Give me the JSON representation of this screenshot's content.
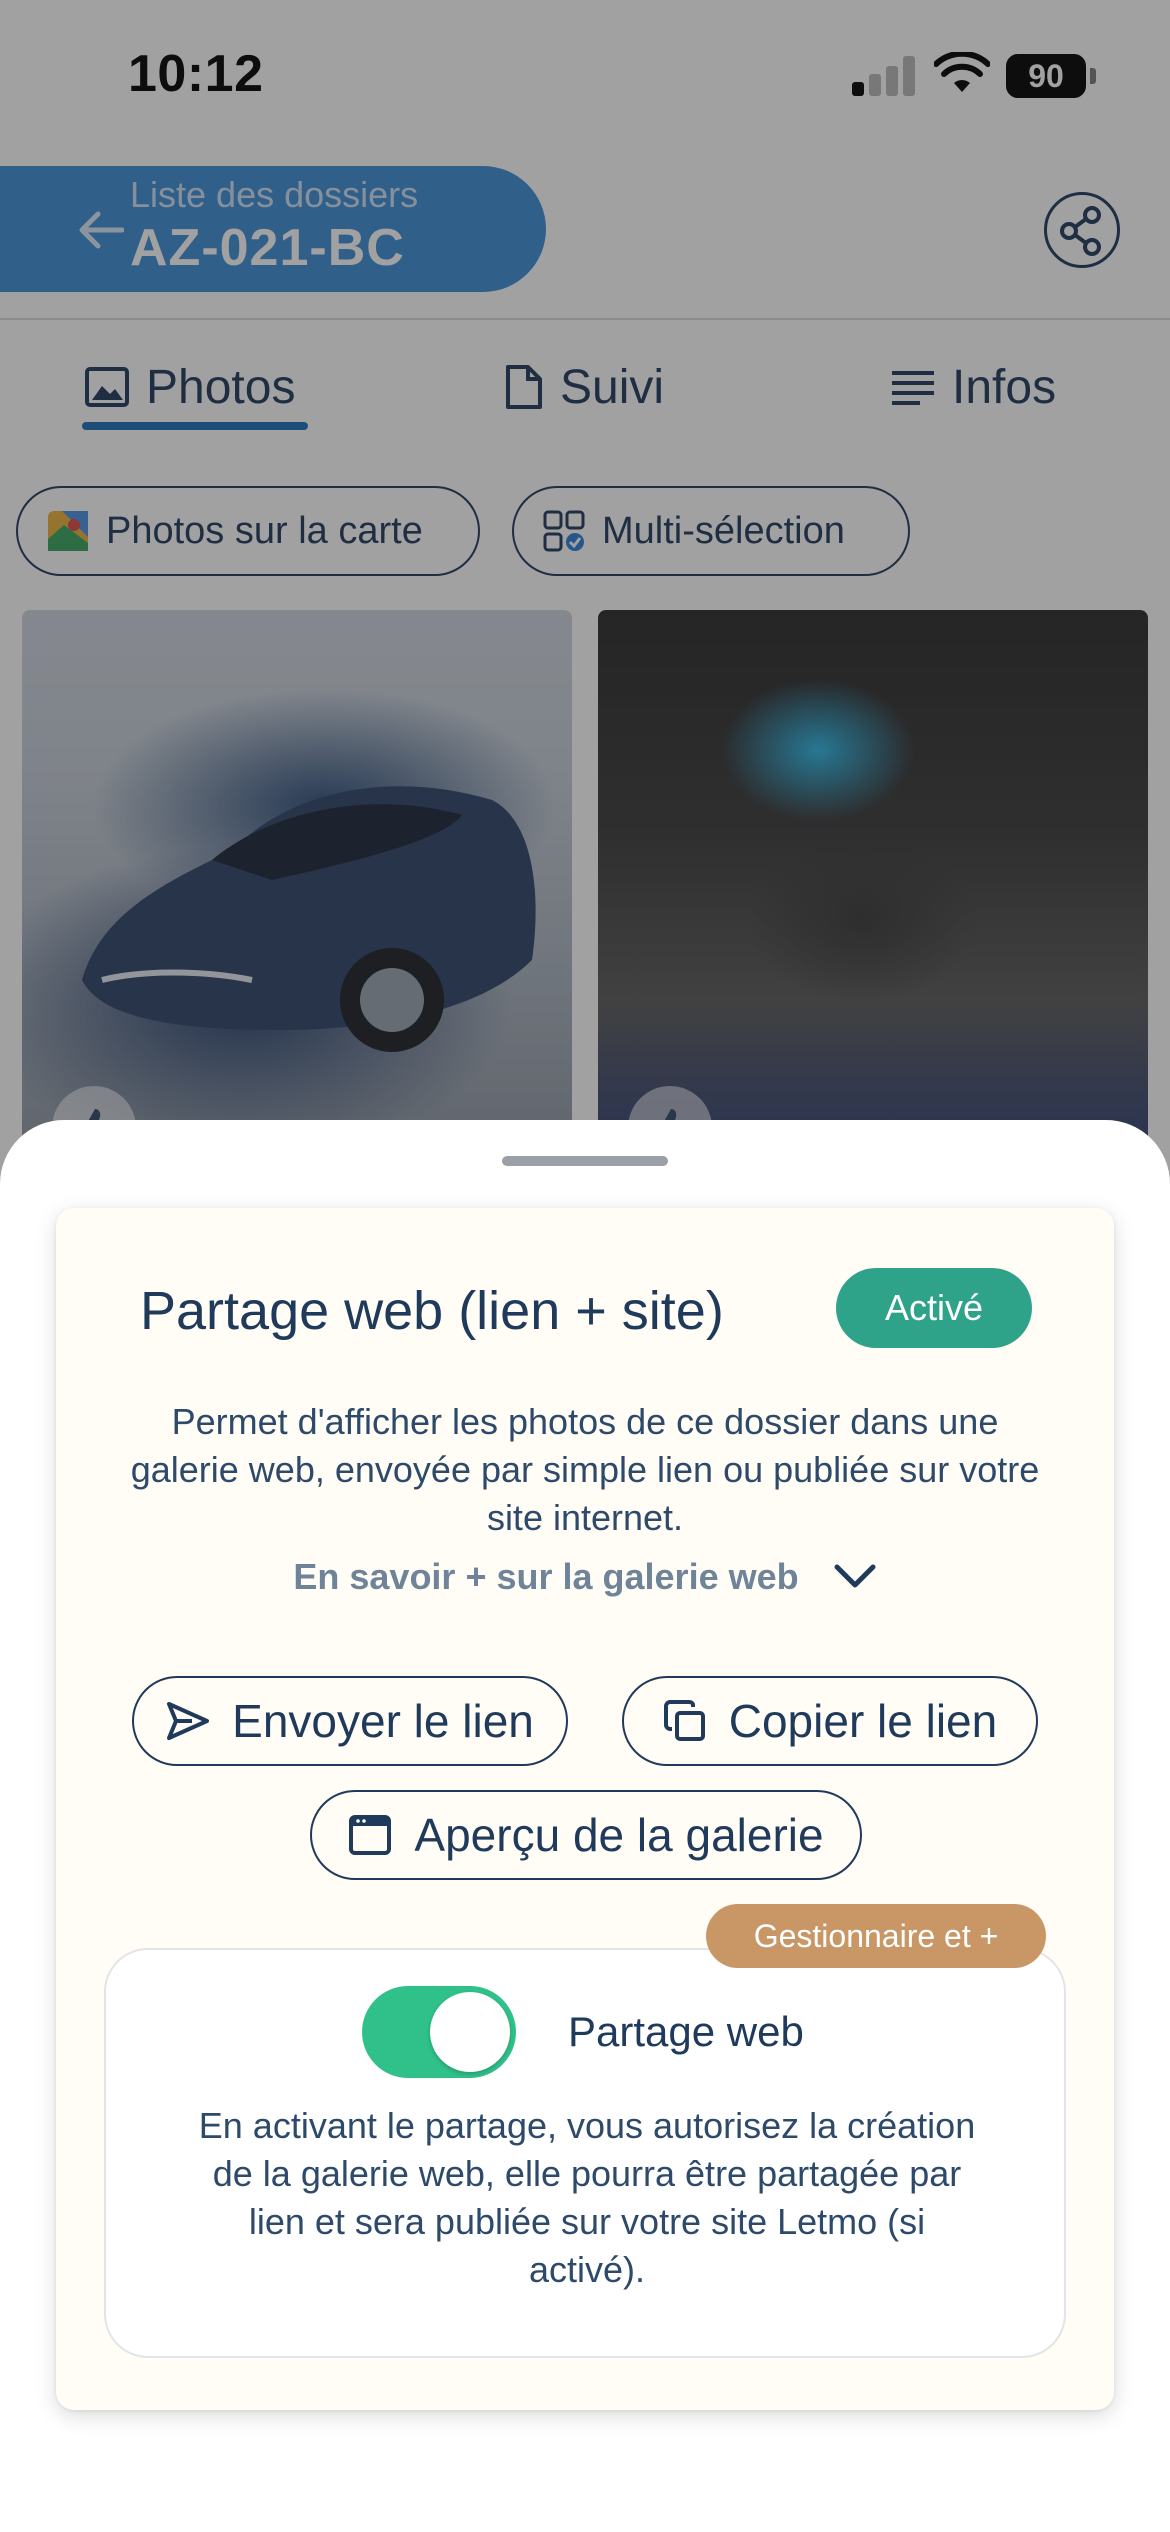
{
  "status_bar": {
    "time": "10:12",
    "battery": "90"
  },
  "header": {
    "subtitle": "Liste des dossiers",
    "title": "AZ-021-BC",
    "back_icon": "arrow-left-icon",
    "share_icon": "share-icon"
  },
  "tabs": [
    {
      "label": "Photos",
      "icon": "image-icon",
      "active": true
    },
    {
      "label": "Suivi",
      "icon": "document-icon",
      "active": false
    },
    {
      "label": "Infos",
      "icon": "lines-icon",
      "active": false
    }
  ],
  "chips": [
    {
      "label": "Photos sur la carte",
      "icon": "map-icon"
    },
    {
      "label": "Multi-sélection",
      "icon": "grid-check-icon"
    }
  ],
  "photos": [
    {
      "subject": "car",
      "like_icon": "thumbs-up-icon"
    },
    {
      "subject": "engine",
      "like_icon": "thumbs-up-icon"
    }
  ],
  "sheet": {
    "title": "Partage web (lien + site)",
    "status": "Activé",
    "description": "Permet d'afficher les photos de ce dossier dans une galerie web, envoyée par simple lien ou publiée sur votre site internet.",
    "learn_more": "En savoir + sur la galerie web",
    "buttons": {
      "send_link": "Envoyer le lien",
      "copy_link": "Copier le lien",
      "preview": "Aperçu de la galerie"
    },
    "role_badge": "Gestionnaire et +",
    "toggle_label": "Partage web",
    "toggle_on": true,
    "permission_text": "En activant le partage, vous autorisez la création de la galerie web, elle pourra être partagée par lien et sera publiée sur votre site Letmo (si activé)."
  },
  "colors": {
    "primary": "#1f3a5a",
    "accent_blue": "#3d8fd6",
    "active_green": "#2fa38a",
    "toggle_green": "#30c08a",
    "role_badge": "#c99766",
    "card_bg": "#fffdf6"
  }
}
